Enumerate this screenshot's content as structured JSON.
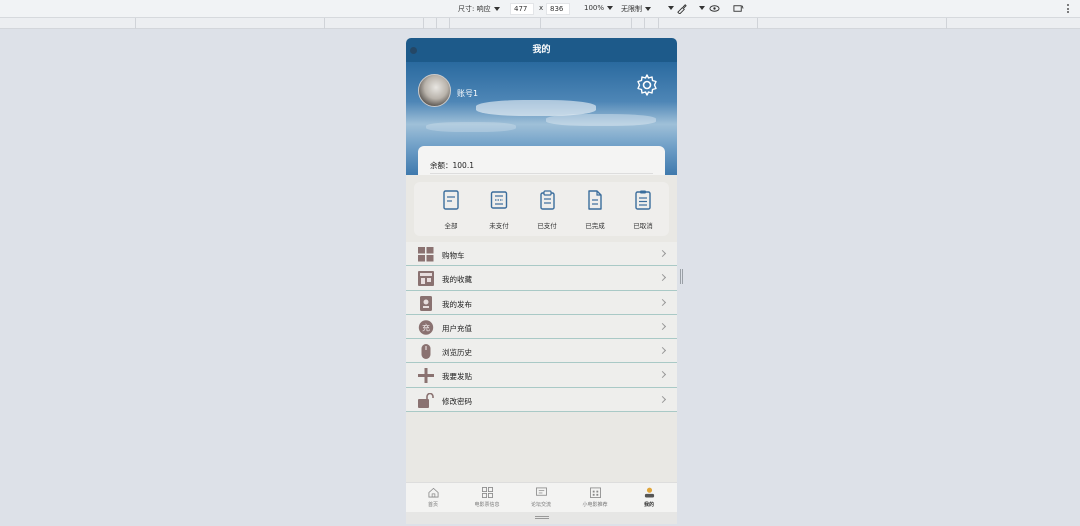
{
  "devtools": {
    "dimensions_label": "尺寸: 响应",
    "width_value": "477",
    "times": "x",
    "height_value": "836",
    "zoom": "100%",
    "throttle": "无限制"
  },
  "header": {
    "title": "我的"
  },
  "profile": {
    "account_name": "账号1"
  },
  "balance": {
    "text": "余额：100.1"
  },
  "orders": [
    {
      "label": "全部",
      "icon": "order-all-icon"
    },
    {
      "label": "未支付",
      "icon": "order-unpaid-icon"
    },
    {
      "label": "已支付",
      "icon": "order-paid-icon"
    },
    {
      "label": "已完成",
      "icon": "order-completed-icon"
    },
    {
      "label": "已取消",
      "icon": "order-cancelled-icon"
    }
  ],
  "menu": [
    {
      "label": "购物车",
      "icon": "grid-icon"
    },
    {
      "label": "我的收藏",
      "icon": "shop-icon"
    },
    {
      "label": "我的发布",
      "icon": "post-icon"
    },
    {
      "label": "用户充值",
      "icon": "recharge-icon"
    },
    {
      "label": "浏览历史",
      "icon": "history-icon"
    },
    {
      "label": "我要发贴",
      "icon": "plus-icon"
    },
    {
      "label": "修改密码",
      "icon": "unlock-icon"
    }
  ],
  "tabs": [
    {
      "label": "首页",
      "icon": "home-icon",
      "active": false
    },
    {
      "label": "电影票信息",
      "icon": "grid-icon",
      "active": false
    },
    {
      "label": "论坛交流",
      "icon": "message-icon",
      "active": false
    },
    {
      "label": "小电影推荐",
      "icon": "calendar-icon",
      "active": false
    },
    {
      "label": "我的",
      "icon": "user-icon",
      "active": true
    }
  ],
  "colors": {
    "nav": "#1d5a8a",
    "icon_brown": "#8a7271",
    "icon_blue": "#3b6d9c"
  }
}
